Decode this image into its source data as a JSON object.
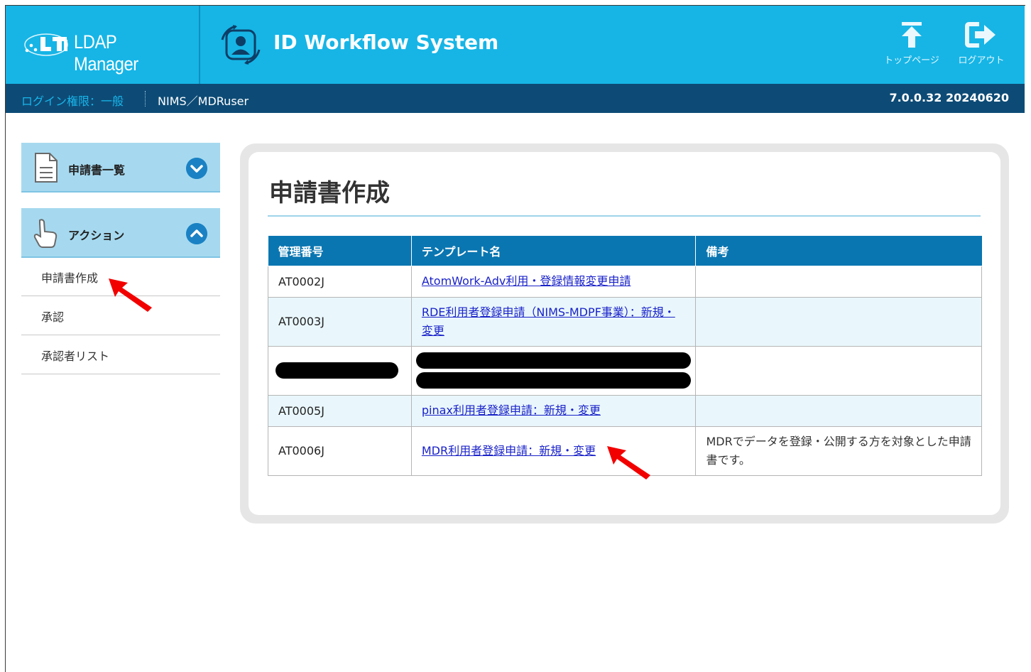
{
  "header": {
    "brand": "LDAP Manager",
    "system_title": "ID Workflow System",
    "buttons": {
      "top_page": "トップページ",
      "logout": "ログアウト"
    },
    "colors": {
      "header_bg": "#16b5e6",
      "subbar_bg": "#0d4b76"
    }
  },
  "subbar": {
    "permission": "ログイン権限：一般",
    "user": "NIMS／MDRuser",
    "version": "7.0.0.32 20240620"
  },
  "sidebar": {
    "sections": [
      {
        "label": "申請書一覧",
        "icon": "document-icon",
        "expanded": false
      },
      {
        "label": "アクション",
        "icon": "hand-pointer-icon",
        "expanded": true
      }
    ],
    "items": [
      {
        "label": "申請書作成"
      },
      {
        "label": "承認"
      },
      {
        "label": "承認者リスト"
      }
    ]
  },
  "main": {
    "title": "申請書作成",
    "table": {
      "headers": [
        "管理番号",
        "テンプレート名",
        "備考"
      ],
      "rows": [
        {
          "id": "AT0002J",
          "name": "AtomWork-Adv利用・登録情報変更申請",
          "note": ""
        },
        {
          "id": "AT0003J",
          "name": "RDE利用者登録申請（NIMS-MDPF事業）：新規・変更",
          "note": ""
        },
        {
          "id": "",
          "name": "",
          "note": "",
          "redacted": true
        },
        {
          "id": "AT0005J",
          "name": "pinax利用者登録申請：新規・変更",
          "note": ""
        },
        {
          "id": "AT0006J",
          "name": "MDR利用者登録申請：新規・変更",
          "note": "MDRでデータを登録・公開する方を対象とした申請書です。"
        }
      ]
    }
  }
}
